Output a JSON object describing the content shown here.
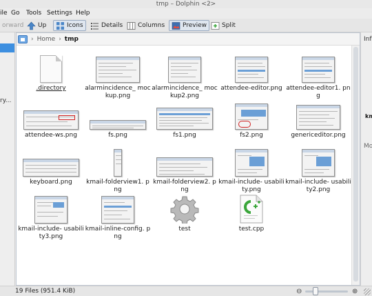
{
  "window": {
    "title": "tmp – Dolphin <2>"
  },
  "menu": {
    "file": "ile",
    "go": "Go",
    "tools": "Tools",
    "settings": "Settings",
    "help": "Help"
  },
  "toolbar": {
    "forward": "orward",
    "up": "Up",
    "icons": "Icons",
    "details": "Details",
    "columns": "Columns",
    "preview": "Preview",
    "split": "Split"
  },
  "breadcrumb": {
    "home": "Home",
    "current": "tmp"
  },
  "left_panel": {
    "fragment": "ry..."
  },
  "right_panel": {
    "heading": "Inf",
    "name_fragment": "km",
    "more_fragment": "Mo"
  },
  "files": [
    {
      "name": ".directory",
      "kind": "doc"
    },
    {
      "name": "alarmincidence_ mockup.png",
      "kind": "shot"
    },
    {
      "name": "alarmincidence_ mockup2.png",
      "kind": "shot"
    },
    {
      "name": "attendee-editor.png",
      "kind": "shot"
    },
    {
      "name": "attendee-editor1. png",
      "kind": "shot"
    },
    {
      "name": "attendee-ws.png",
      "kind": "shot"
    },
    {
      "name": "fs.png",
      "kind": "shot"
    },
    {
      "name": "fs1.png",
      "kind": "shot"
    },
    {
      "name": "fs2.png",
      "kind": "shot"
    },
    {
      "name": "genericeditor.png",
      "kind": "shot"
    },
    {
      "name": "keyboard.png",
      "kind": "shot"
    },
    {
      "name": "kmail-folderview1. png",
      "kind": "shot"
    },
    {
      "name": "kmail-folderview2. png",
      "kind": "shot"
    },
    {
      "name": "kmail-include- usability.png",
      "kind": "shot"
    },
    {
      "name": "kmail-include- usability2.png",
      "kind": "shot"
    },
    {
      "name": "kmail-include- usability3.png",
      "kind": "shot"
    },
    {
      "name": "kmail-inline-config. png",
      "kind": "shot"
    },
    {
      "name": "test",
      "kind": "gear"
    },
    {
      "name": "test.cpp",
      "kind": "cpp"
    }
  ],
  "status": {
    "summary": "19 Files (951.4 KiB)"
  },
  "colors": {
    "accent": "#3d8fe0",
    "selected_tool": "#dfe6ef"
  }
}
